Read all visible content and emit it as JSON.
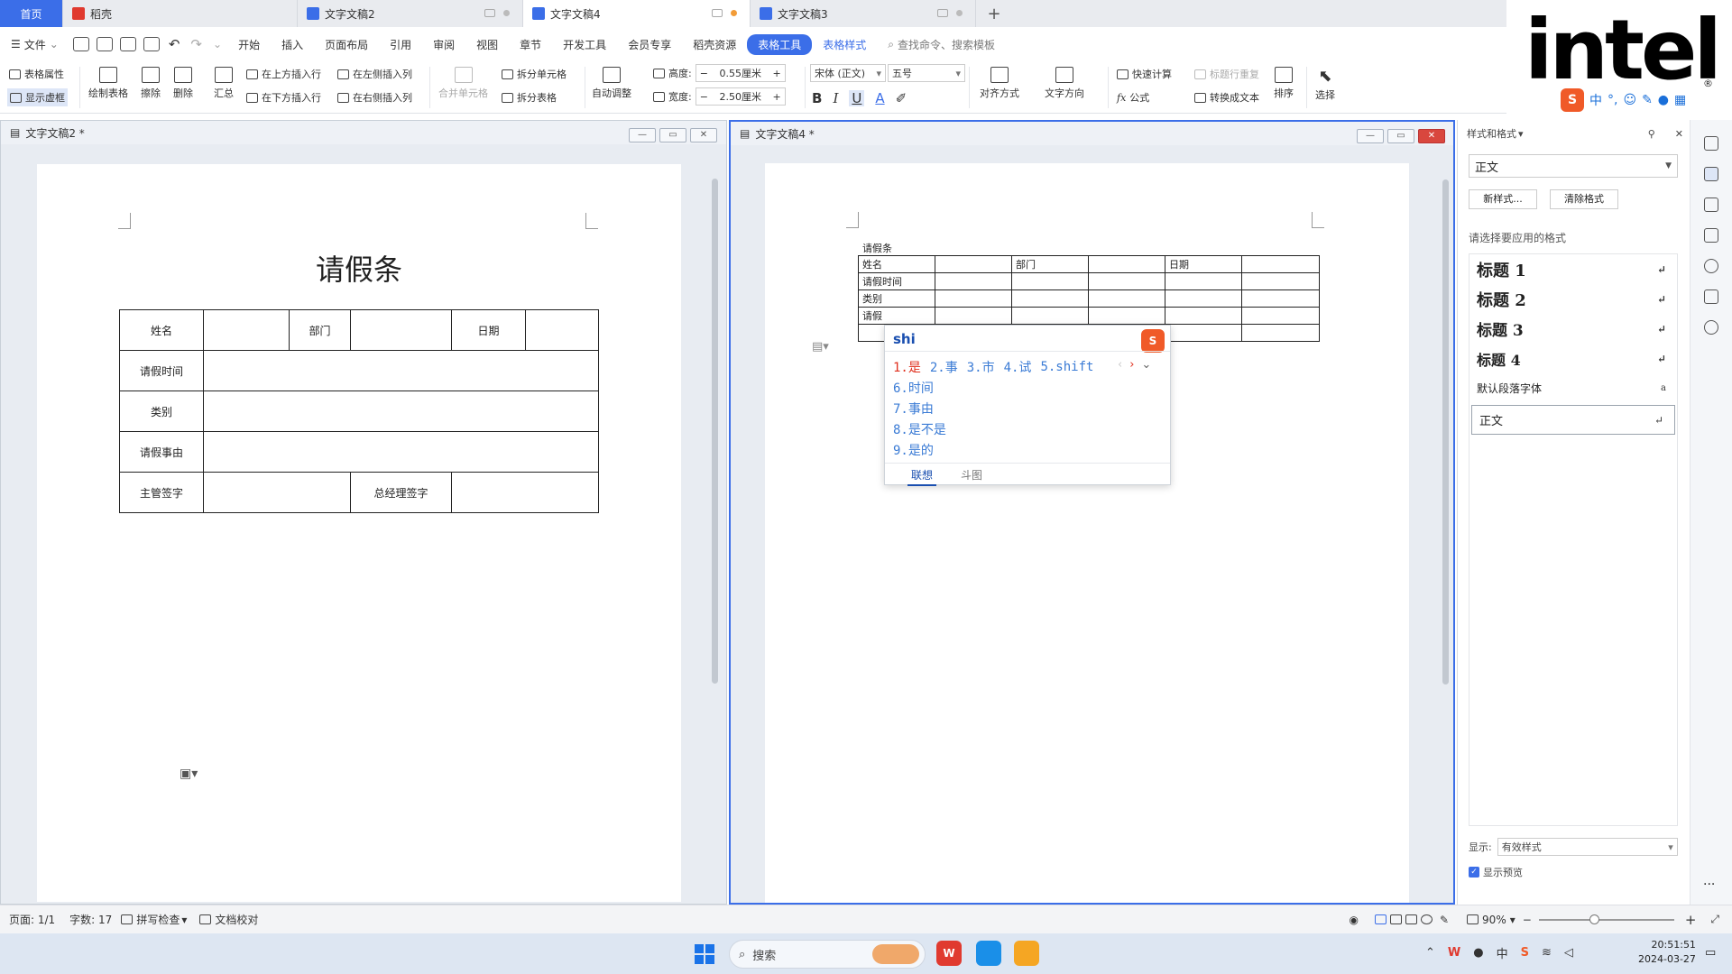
{
  "tabs": [
    {
      "label": "首页",
      "kind": "home"
    },
    {
      "label": "稻壳",
      "kind": "docer"
    },
    {
      "label": "文字文稿2",
      "kind": "doc"
    },
    {
      "label": "文字文稿4",
      "kind": "doc-active"
    },
    {
      "label": "文字文稿3",
      "kind": "doc"
    }
  ],
  "menu": {
    "file": "文件",
    "items": [
      "开始",
      "插入",
      "页面布局",
      "引用",
      "审阅",
      "视图",
      "章节",
      "开发工具",
      "会员专享",
      "稻壳资源"
    ],
    "table_tools": "表格工具",
    "table_style": "表格样式",
    "search": "查找命令、搜索模板"
  },
  "ribbon": {
    "table_props": "表格属性",
    "show_virtual": "显示虚框",
    "draw_table": "绘制表格",
    "erase": "擦除",
    "delete": "删除",
    "summary": "汇总",
    "insert_above": "在上方插入行",
    "insert_below": "在下方插入行",
    "insert_left": "在左侧插入列",
    "insert_right": "在右侧插入列",
    "merge_cells": "合并单元格",
    "split_cells": "拆分单元格",
    "split_table": "拆分表格",
    "auto_adjust": "自动调整",
    "height_label": "高度:",
    "height_value": "0.55厘米",
    "width_label": "宽度:",
    "width_value": "2.50厘米",
    "font": "宋体 (正文)",
    "size": "五号",
    "align": "对齐方式",
    "text_dir": "文字方向",
    "quick_calc": "快速计算",
    "formula": "公式",
    "title_repeat": "标题行重复",
    "to_text": "转换成文本",
    "sort": "排序",
    "select": "选择"
  },
  "left_window": {
    "title": "文字文稿2 *",
    "doc_title": "请假条",
    "rows": [
      [
        "姓名",
        "",
        "部门",
        "",
        "日期",
        ""
      ],
      [
        "请假时间",
        ""
      ],
      [
        "类别",
        ""
      ],
      [
        "请假事由",
        ""
      ],
      [
        "主管签字",
        "",
        "总经理签字",
        ""
      ]
    ]
  },
  "right_window": {
    "title": "文字文稿4 *",
    "caption": "请假条",
    "rows": [
      [
        "姓名",
        "",
        "部门",
        "",
        "日期",
        ""
      ],
      [
        "请假时间",
        "",
        "",
        "",
        "",
        ""
      ],
      [
        "类别",
        "",
        "",
        "",
        "",
        ""
      ],
      [
        "请假",
        "",
        "",
        "",
        "",
        ""
      ],
      [
        "",
        "",
        "",
        "",
        "",
        ""
      ]
    ]
  },
  "ime": {
    "input": "shi",
    "row1": [
      "1.是",
      "2.事",
      "3.市",
      "4.试",
      "5.shift"
    ],
    "list": [
      "6.时间",
      "7.事由",
      "8.是不是",
      "9.是的"
    ],
    "tab_assoc": "联想",
    "tab_meme": "斗图"
  },
  "panel": {
    "title": "样式和格式",
    "current": "正文",
    "new_style": "新样式...",
    "clear_format": "清除格式",
    "prompt": "请选择要应用的格式",
    "styles": [
      "标题  1",
      "标题  2",
      "标题  3",
      "标题  4",
      "默认段落字体",
      "正文"
    ],
    "show_label": "显示:",
    "show_value": "有效样式",
    "show_preview": "显示预览"
  },
  "logo": {
    "text": "intel",
    "reg": "®"
  },
  "sogou_bar": [
    "中",
    "°,"
  ],
  "status": {
    "page": "页面: 1/1",
    "words": "字数: 17",
    "spell": "拼写检查",
    "proof": "文档校对",
    "zoom": "90%"
  },
  "taskbar": {
    "search": "搜索",
    "time": "20:51:51",
    "date": "2024-03-27",
    "lang": "中"
  },
  "colors": {
    "accent": "#3b6ee8",
    "sogou": "#f05a28",
    "close": "#d9473e"
  }
}
